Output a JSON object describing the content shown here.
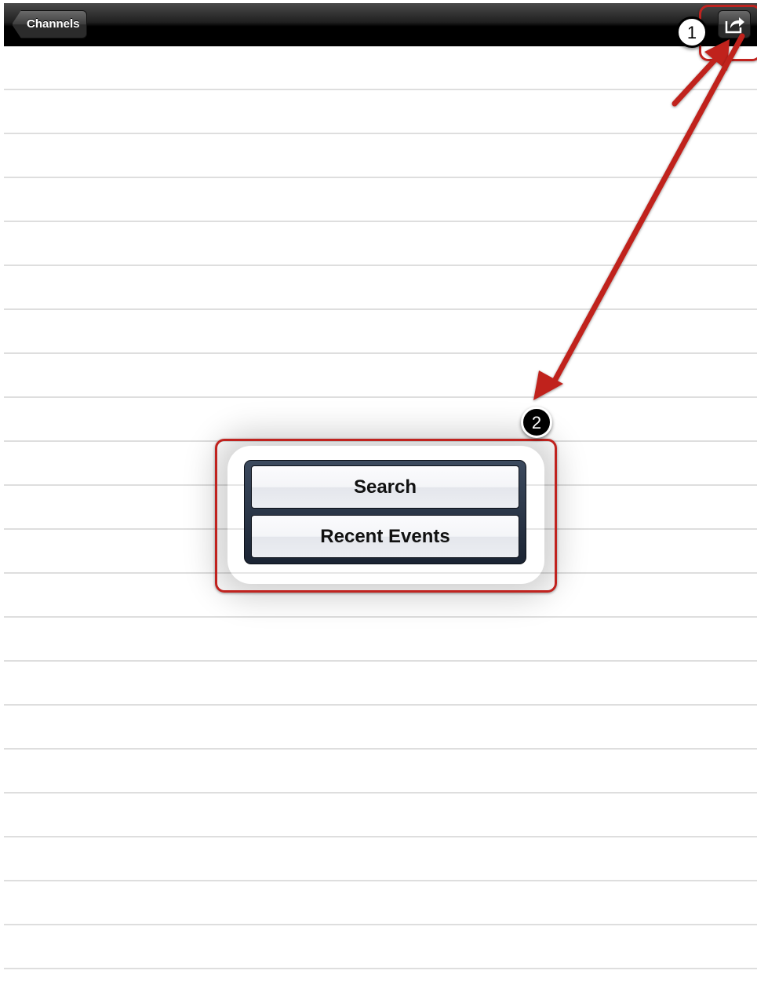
{
  "navbar": {
    "back_label": "Channels",
    "share_icon": "share-icon"
  },
  "popover": {
    "items": [
      {
        "label": "Search"
      },
      {
        "label": "Recent Events"
      }
    ]
  },
  "annotations": {
    "step_one": "1",
    "step_two": "2",
    "color": "#c0231f"
  }
}
